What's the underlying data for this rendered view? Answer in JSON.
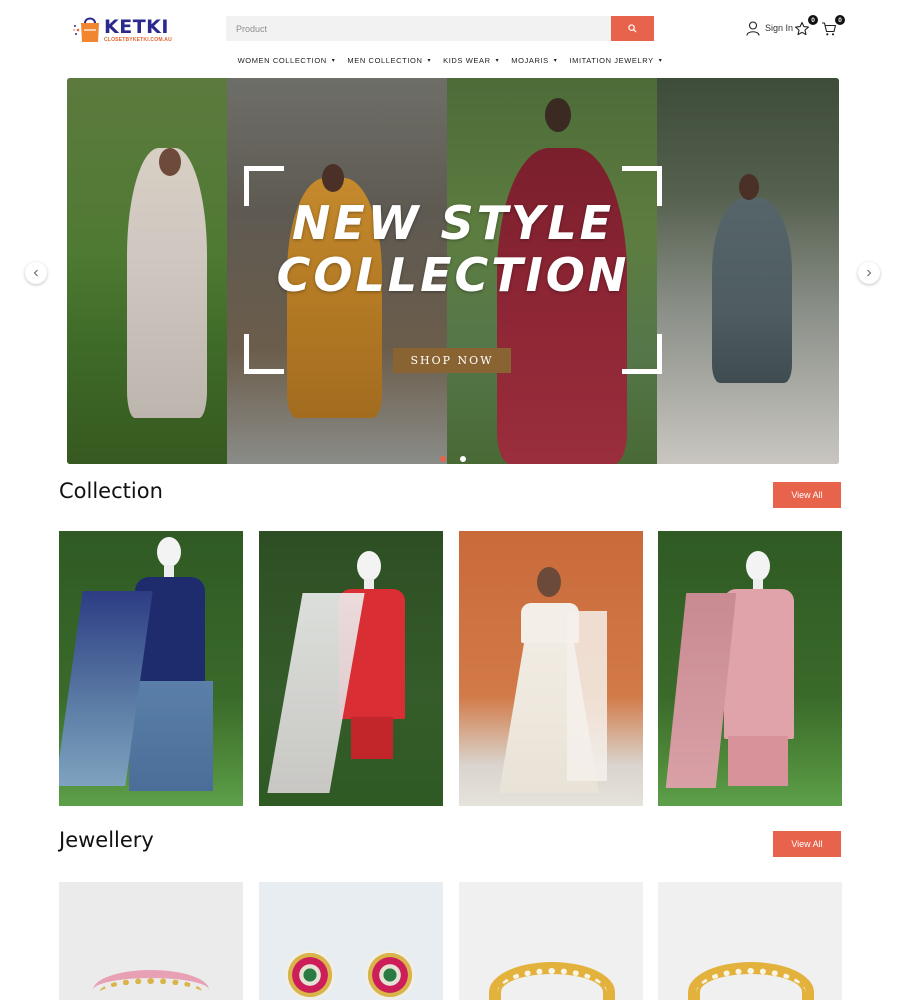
{
  "header": {
    "logo_text": "KETKI",
    "logo_subtext": "CLOSETBYKETKI.COM.AU",
    "search_placeholder": "Product",
    "sign_in_label": "Sign In",
    "wishlist_count": "0",
    "cart_count": "0",
    "icons": [
      "search-icon",
      "user-icon",
      "heart-icon",
      "cart-icon"
    ],
    "accent_color": "#e8634c"
  },
  "nav": {
    "items": [
      {
        "label": "WOMEN COLLECTION"
      },
      {
        "label": "MEN COLLECTION"
      },
      {
        "label": "KIDS WEAR"
      },
      {
        "label": "MOJARIS"
      },
      {
        "label": "IMITATION JEWELRY"
      }
    ]
  },
  "hero": {
    "title_line1": "NEW STYLE",
    "title_line2": "COLLECTION",
    "cta_label": "SHOP NOW",
    "slide_count": 2,
    "active_slide": 1
  },
  "collection": {
    "title": "Collection",
    "view_all_label": "View All",
    "products": [
      {
        "image": "navy-blue-sharara-suit"
      },
      {
        "image": "red-kurta-with-white-dupatta"
      },
      {
        "image": "ivory-lehenga-choli"
      },
      {
        "image": "pink-palazzo-suit"
      }
    ]
  },
  "jewellery": {
    "title": "Jewellery",
    "view_all_label": "View All",
    "products": [
      {
        "image": "pink-choker-necklace"
      },
      {
        "image": "kundan-stud-earrings"
      },
      {
        "image": "gold-kundan-bangles"
      },
      {
        "image": "gold-kundan-bangles"
      }
    ]
  }
}
